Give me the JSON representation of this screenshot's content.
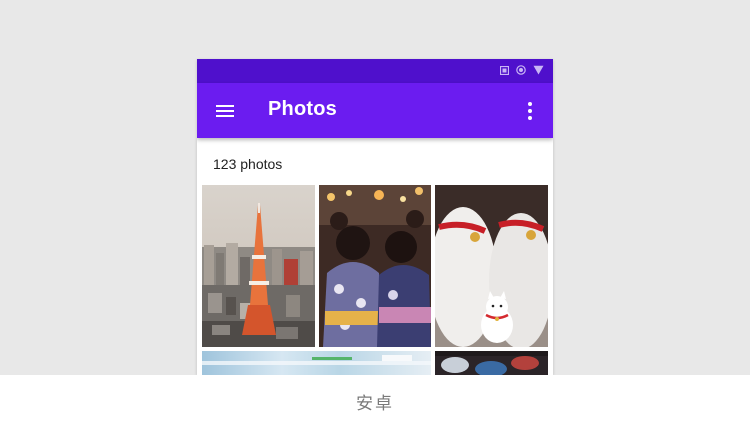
{
  "colors": {
    "status_bar": "#4f10cc",
    "app_bar": "#6b1cf0",
    "page_background": "#e8e8e8",
    "content_background": "#ffffff"
  },
  "status_bar": {
    "icons": [
      "square-icon",
      "circle-icon",
      "triangle-icon"
    ]
  },
  "app_bar": {
    "menu_icon": "hamburger-menu-icon",
    "title": "Photos",
    "overflow_icon": "more-vertical-icon"
  },
  "gallery": {
    "count_label": "123 photos",
    "photos": [
      {
        "subject": "tokyo-tower-cityscape"
      },
      {
        "subject": "festival-kimono-crowd"
      },
      {
        "subject": "maneki-neko-cats"
      },
      {
        "subject": "blurred-motion-street"
      },
      {
        "subject": "lanterns-night"
      }
    ]
  },
  "footer": {
    "caption": "安卓"
  }
}
